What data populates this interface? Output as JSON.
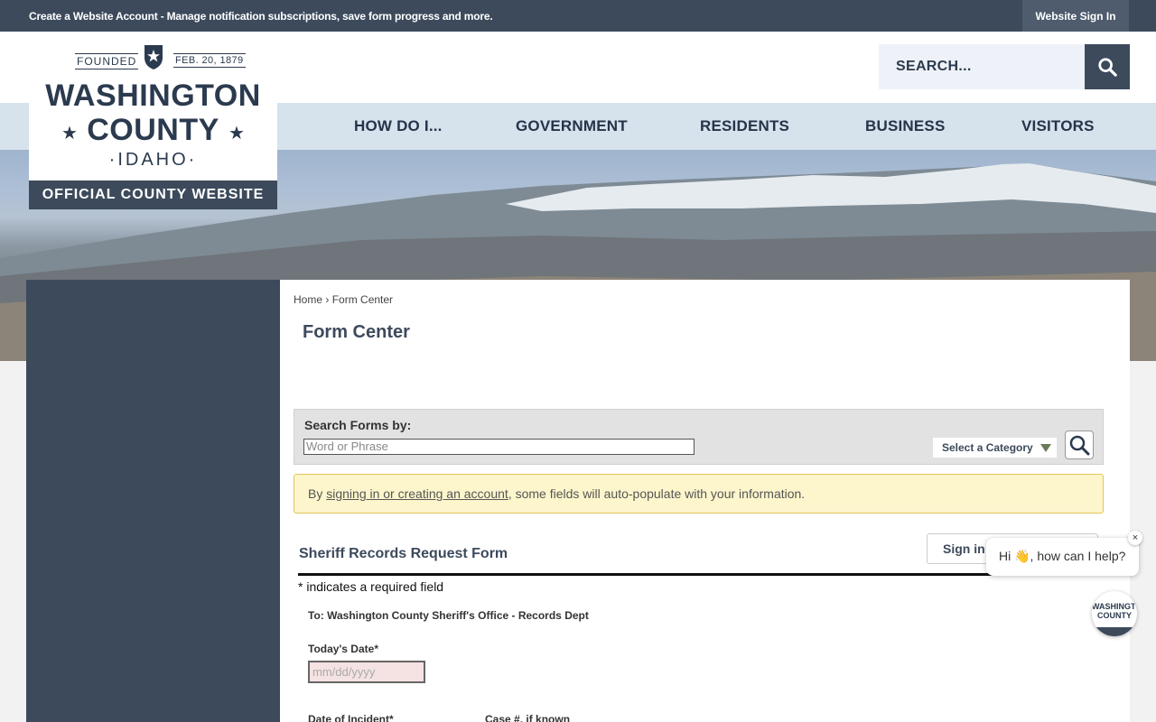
{
  "topbar": {
    "message": "Create a Website Account - Manage notification subscriptions, save form progress and more.",
    "signin_label": "Website Sign In"
  },
  "header": {
    "search_placeholder": "SEARCH..."
  },
  "logo": {
    "founded": "FOUNDED",
    "founded_date": "FEB. 20, 1879",
    "line1": "WASHINGTON",
    "line2": "COUNTY",
    "state": "·IDAHO·",
    "tagline": "OFFICIAL COUNTY WEBSITE"
  },
  "nav": {
    "items": [
      "HOW DO I...",
      "GOVERNMENT",
      "RESIDENTS",
      "BUSINESS",
      "VISITORS"
    ]
  },
  "breadcrumb": {
    "home": "Home",
    "sep": "›",
    "current": "Form Center"
  },
  "page": {
    "title": "Form Center"
  },
  "search_forms": {
    "label": "Search Forms by:",
    "phrase_placeholder": "Word or Phrase",
    "category_label": "Select a Category"
  },
  "notice": {
    "prefix": "By ",
    "link": "signing in or creating an account",
    "suffix": ", some fields will auto-populate with your information."
  },
  "form": {
    "title": "Sheriff Records Request Form",
    "signin_label": "Sign in",
    "required_note": "* indicates a required field",
    "to_line": "To: Washington County Sheriff's Office - Records Dept",
    "todays_date_label": "Today's Date*",
    "date_placeholder": "mm/dd/yyyy",
    "incident_date_label": "Date of Incident*",
    "case_label": "Case #, if known"
  },
  "chat": {
    "message": "Hi 👋, how can I help?",
    "close": "×",
    "avatar_text": "WASHINGTON COUNTY"
  },
  "colors": {
    "primary": "#3c4a5c",
    "nav_bg": "#d6e2ec",
    "notice_bg": "#fdf6cc"
  }
}
